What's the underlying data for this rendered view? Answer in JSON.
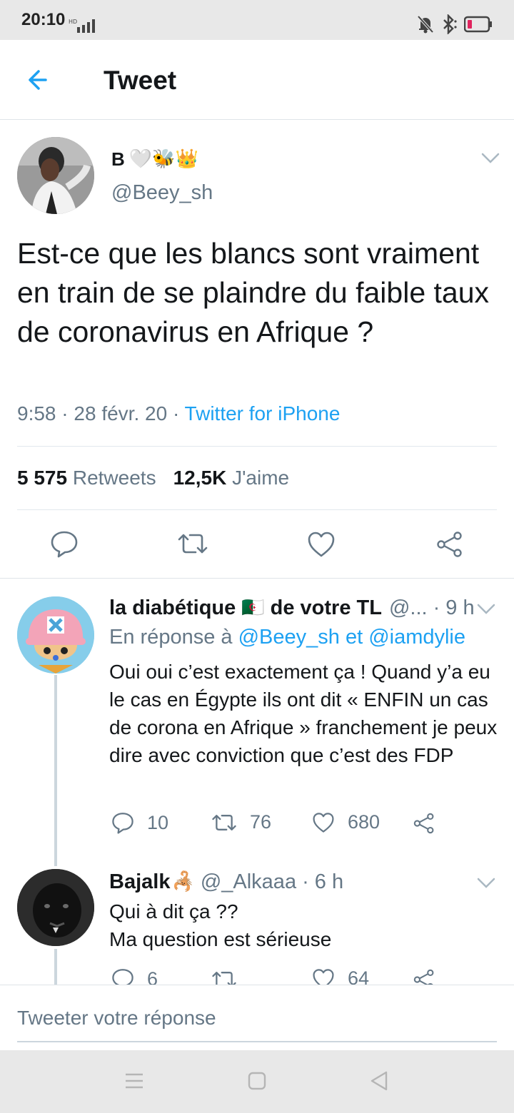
{
  "status_bar": {
    "time": "20:10"
  },
  "header": {
    "title": "Tweet"
  },
  "tweet": {
    "author_name": "B",
    "author_emojis": "🤍🐝👑",
    "author_handle": "@Beey_sh",
    "text": "Est-ce que les blancs sont vraiment en train de se plaindre du faible taux de coronavirus en Afrique ?",
    "time": "9:58",
    "date": "28 févr. 20",
    "separator": "·",
    "source": "Twitter for iPhone",
    "retweets_count": "5 575",
    "retweets_label": "Retweets",
    "likes_count": "12,5K",
    "likes_label": "J'aime"
  },
  "replies": [
    {
      "name_part1": "la diabétique",
      "flag": "🇩🇿",
      "name_part2": "de votre TL",
      "handle": "@...",
      "time": "· 9 h",
      "in_reply_prefix": "En réponse à",
      "mention1": "@Beey_sh",
      "in_reply_and": "et",
      "mention2": "@iamdylie",
      "text": "Oui oui c’est exactement ça ! Quand y’a eu le cas en Égypte ils ont dit « ENFIN un cas de corona en Afrique » franchement je peux dire avec conviction que c’est des FDP",
      "replies_count": "10",
      "retweets_count": "76",
      "likes_count": "680"
    },
    {
      "name": "Bajalk",
      "name_emoji": "🦂",
      "handle": "@_Alkaaa",
      "time": "· 6 h",
      "text_line1": "Qui à dit ça ??",
      "text_line2": "Ma question est sérieuse",
      "replies_count": "6",
      "likes_count": "64"
    }
  ],
  "compose": {
    "placeholder": "Tweeter votre réponse"
  },
  "colors": {
    "accent": "#1da1f2",
    "secondary_text": "#657786",
    "primary_text": "#14171a"
  }
}
